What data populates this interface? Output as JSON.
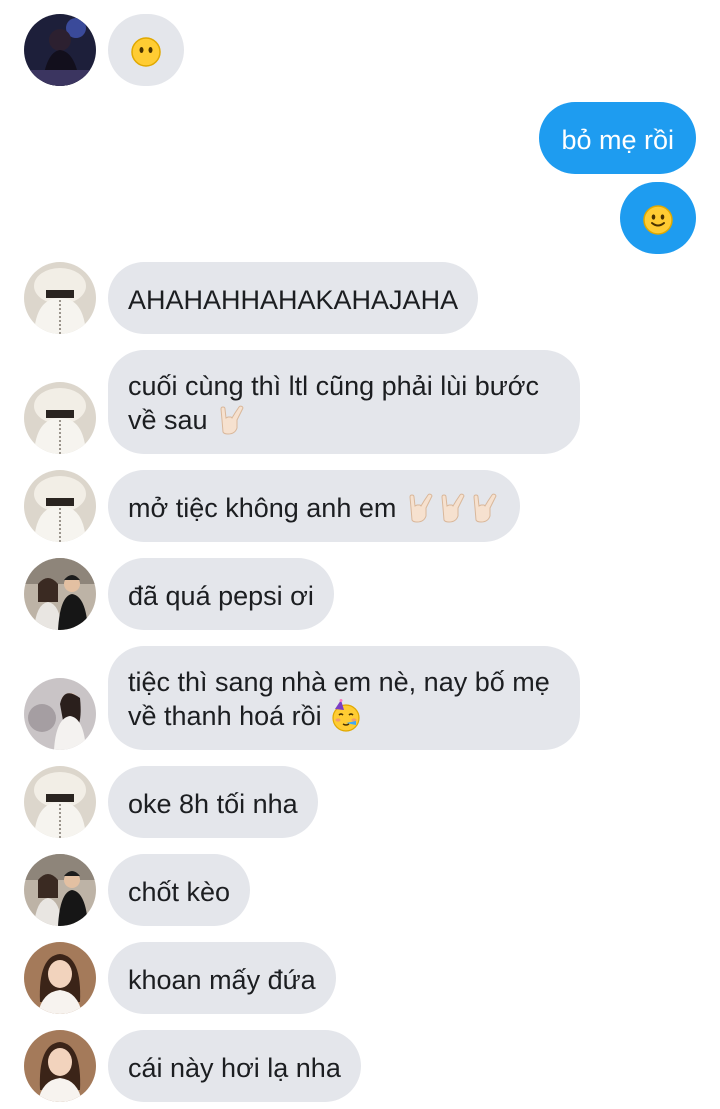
{
  "messages": [
    {
      "id": "m1",
      "side": "in",
      "avatar": "avatar-dark",
      "text": "",
      "emoji": [
        "neutral-face-icon"
      ]
    },
    {
      "id": "m2",
      "side": "out",
      "text": "bỏ mẹ rồi",
      "emoji": []
    },
    {
      "id": "m3",
      "side": "out",
      "text": "",
      "emoji": [
        "slight-smile-icon"
      ]
    },
    {
      "id": "m4",
      "side": "in",
      "avatar": "avatar-hoodie",
      "text": "AHAHAHHAHAKAHAJAHA",
      "emoji": []
    },
    {
      "id": "m5",
      "side": "in",
      "avatar": "avatar-hoodie",
      "line1": "cuối cùng thì ltl cũng phải lùi bước",
      "line2": "về sau",
      "emoji": [
        "rock-hand-icon"
      ]
    },
    {
      "id": "m6",
      "side": "in",
      "avatar": "avatar-hoodie",
      "text": "mở tiệc không anh em",
      "emoji": [
        "rock-hand-icon",
        "rock-hand-icon",
        "rock-hand-icon"
      ]
    },
    {
      "id": "m7",
      "side": "in",
      "avatar": "avatar-couple",
      "text": "đã quá pepsi ơi",
      "emoji": []
    },
    {
      "id": "m8",
      "side": "in",
      "avatar": "avatar-girl-gray",
      "line1": "tiệc thì sang nhà em nè, nay bố mẹ",
      "line2": "về thanh hoá rồi",
      "emoji": [
        "party-face-icon"
      ]
    },
    {
      "id": "m9",
      "side": "in",
      "avatar": "avatar-hoodie",
      "text": "oke 8h tối nha",
      "emoji": []
    },
    {
      "id": "m10",
      "side": "in",
      "avatar": "avatar-couple",
      "text": "chốt kèo",
      "emoji": []
    },
    {
      "id": "m11",
      "side": "in",
      "avatar": "avatar-girl-brown",
      "text": "khoan mấy đứa",
      "emoji": []
    },
    {
      "id": "m12",
      "side": "in",
      "avatar": "avatar-girl-brown",
      "text": "cái này hơi lạ nha",
      "emoji": []
    }
  ],
  "colors": {
    "incoming": "#e4e6eb",
    "outgoing": "#1e9cf0"
  }
}
